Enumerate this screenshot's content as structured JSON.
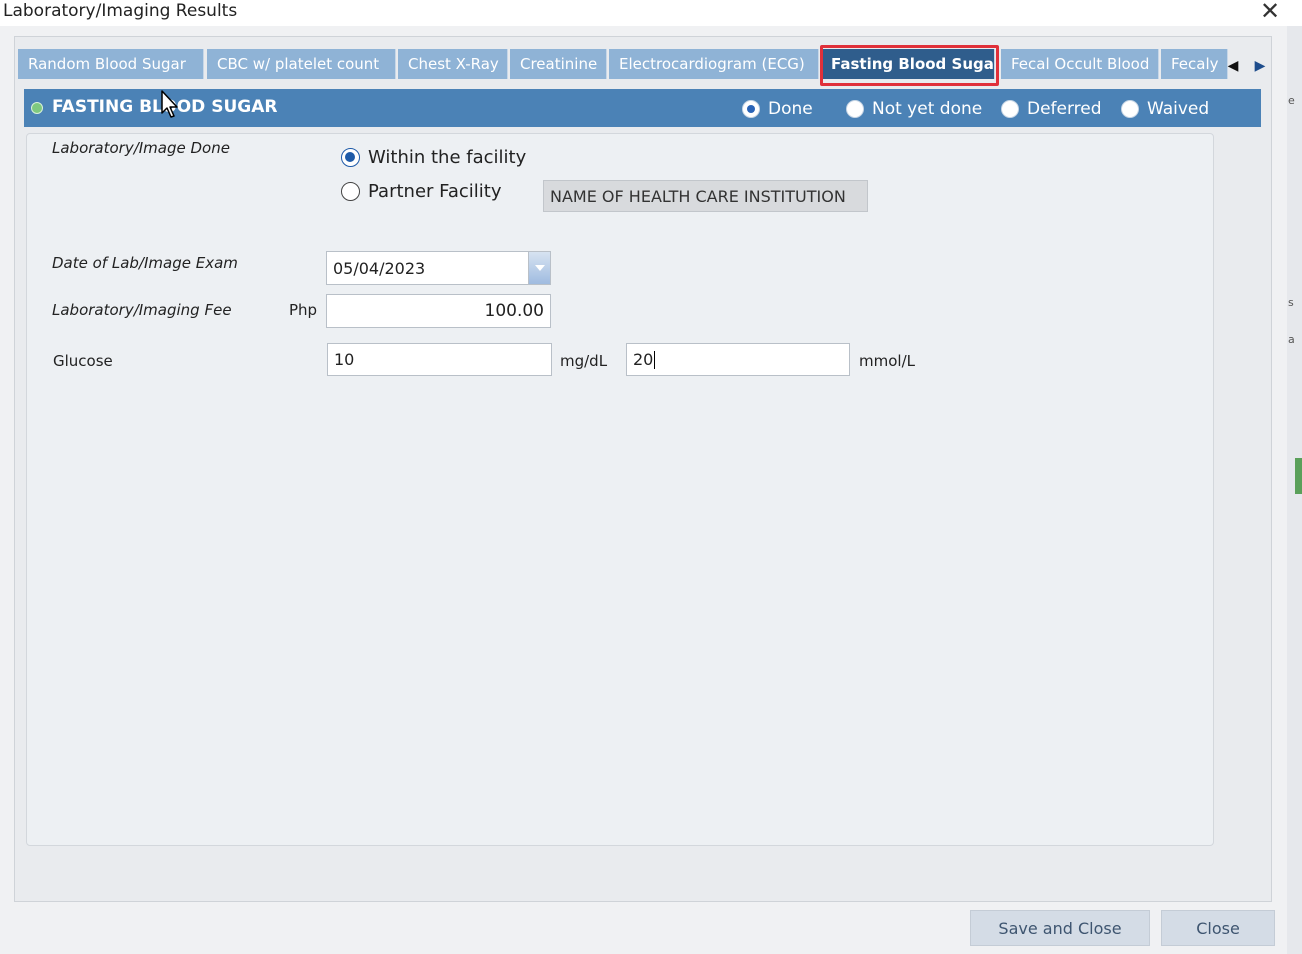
{
  "window": {
    "title": "Laboratory/Imaging Results",
    "right_edge_fragments": [
      "e",
      "s",
      "a"
    ]
  },
  "tabs": [
    {
      "label": "Random Blood Sugar",
      "active": false
    },
    {
      "label": "CBC w/ platelet count",
      "active": false
    },
    {
      "label": "Chest X-Ray",
      "active": false
    },
    {
      "label": "Creatinine",
      "active": false
    },
    {
      "label": "Electrocardiogram (ECG)",
      "active": false
    },
    {
      "label": "Fasting Blood Sugar",
      "active": true
    },
    {
      "label": "Fecal Occult Blood",
      "active": false
    },
    {
      "label": "Fecaly",
      "active": false
    }
  ],
  "section": {
    "title": "FASTING BLOOD SUGAR",
    "status_options": [
      {
        "label": "Done",
        "selected": true
      },
      {
        "label": "Not yet done",
        "selected": false
      },
      {
        "label": "Deferred",
        "selected": false
      },
      {
        "label": "Waived",
        "selected": false
      }
    ]
  },
  "form": {
    "lab_done_label": "Laboratory/Image Done",
    "within_facility_label": "Within the facility",
    "partner_facility_label": "Partner Facility",
    "within_facility_selected": true,
    "institution_placeholder": "NAME OF HEALTH CARE INSTITUTION",
    "date_label": "Date of Lab/Image Exam",
    "date_value": "05/04/2023",
    "fee_label": "Laboratory/Imaging Fee",
    "fee_currency": "Php",
    "fee_value": "100.00",
    "glucose_label": "Glucose",
    "glucose_mgdl_value": "10",
    "glucose_mgdl_unit": "mg/dL",
    "glucose_mmol_value": "20",
    "glucose_mmol_unit": "mmol/L"
  },
  "buttons": {
    "save_close": "Save and Close",
    "close": "Close"
  },
  "colors": {
    "tab_inactive": "#8fb3d6",
    "tab_active": "#2f5d8c",
    "header_bar": "#4b82b6",
    "highlight": "#e0303a"
  }
}
